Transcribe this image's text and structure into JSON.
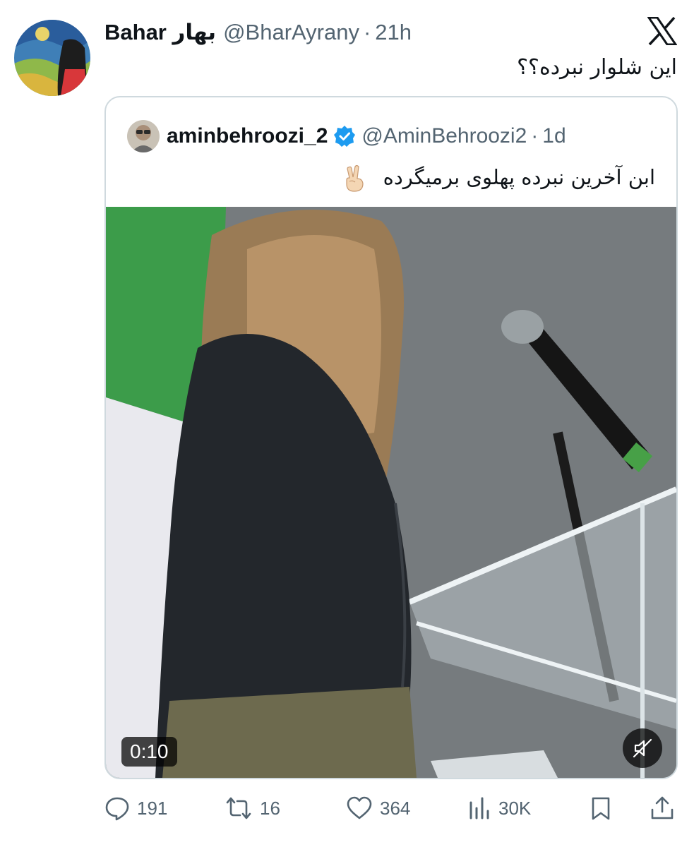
{
  "tweet": {
    "display_name": "Bahar بهار",
    "handle": "@BharAyrany",
    "separator": "·",
    "time": "21h",
    "text": "این شلوار نبرده؟؟"
  },
  "quote": {
    "display_name": "aminbehroozi_2",
    "verified": true,
    "handle": "@AminBehroozi2",
    "separator": "·",
    "time": "1d",
    "text": "ابن آخرین نبرده پهلوی برمیگرده",
    "emoji_icon": "peace-hand-emoji",
    "video": {
      "duration": "0:10",
      "muted": true
    }
  },
  "actions": {
    "replies": "191",
    "retweets": "16",
    "likes": "364",
    "views": "30K"
  },
  "colors": {
    "text": "#0f1419",
    "secondary": "#536471",
    "verified": "#1d9bf0",
    "border": "#cfd9de"
  }
}
